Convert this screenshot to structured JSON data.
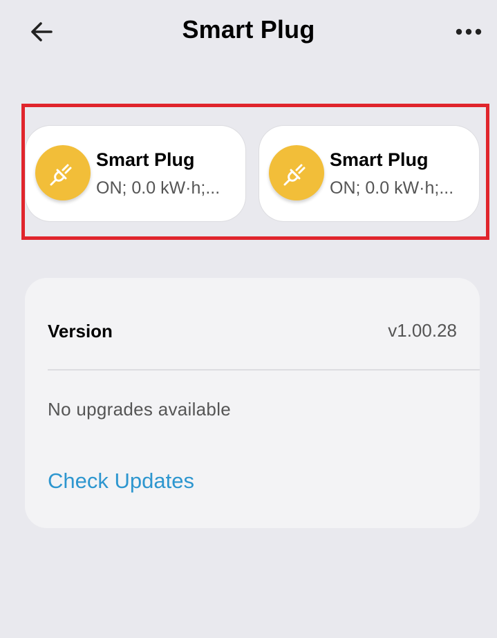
{
  "header": {
    "title": "Smart Plug",
    "back_icon": "arrow-left-icon",
    "more_icon": "more-horizontal-icon"
  },
  "devices": [
    {
      "name": "Smart Plug",
      "status": "ON; 0.0 kW·h;...",
      "icon": "plug-icon"
    },
    {
      "name": "Smart Plug",
      "status": "ON; 0.0 kW·h;...",
      "icon": "plug-icon"
    }
  ],
  "firmware": {
    "version_label": "Version",
    "version_value": "v1.00.28",
    "upgrade_status": "No upgrades available",
    "check_updates_label": "Check Updates"
  },
  "colors": {
    "background": "#e9e9ee",
    "device_icon_bg": "#f2be39",
    "link": "#2d96cf",
    "highlight": "#e0252c"
  }
}
